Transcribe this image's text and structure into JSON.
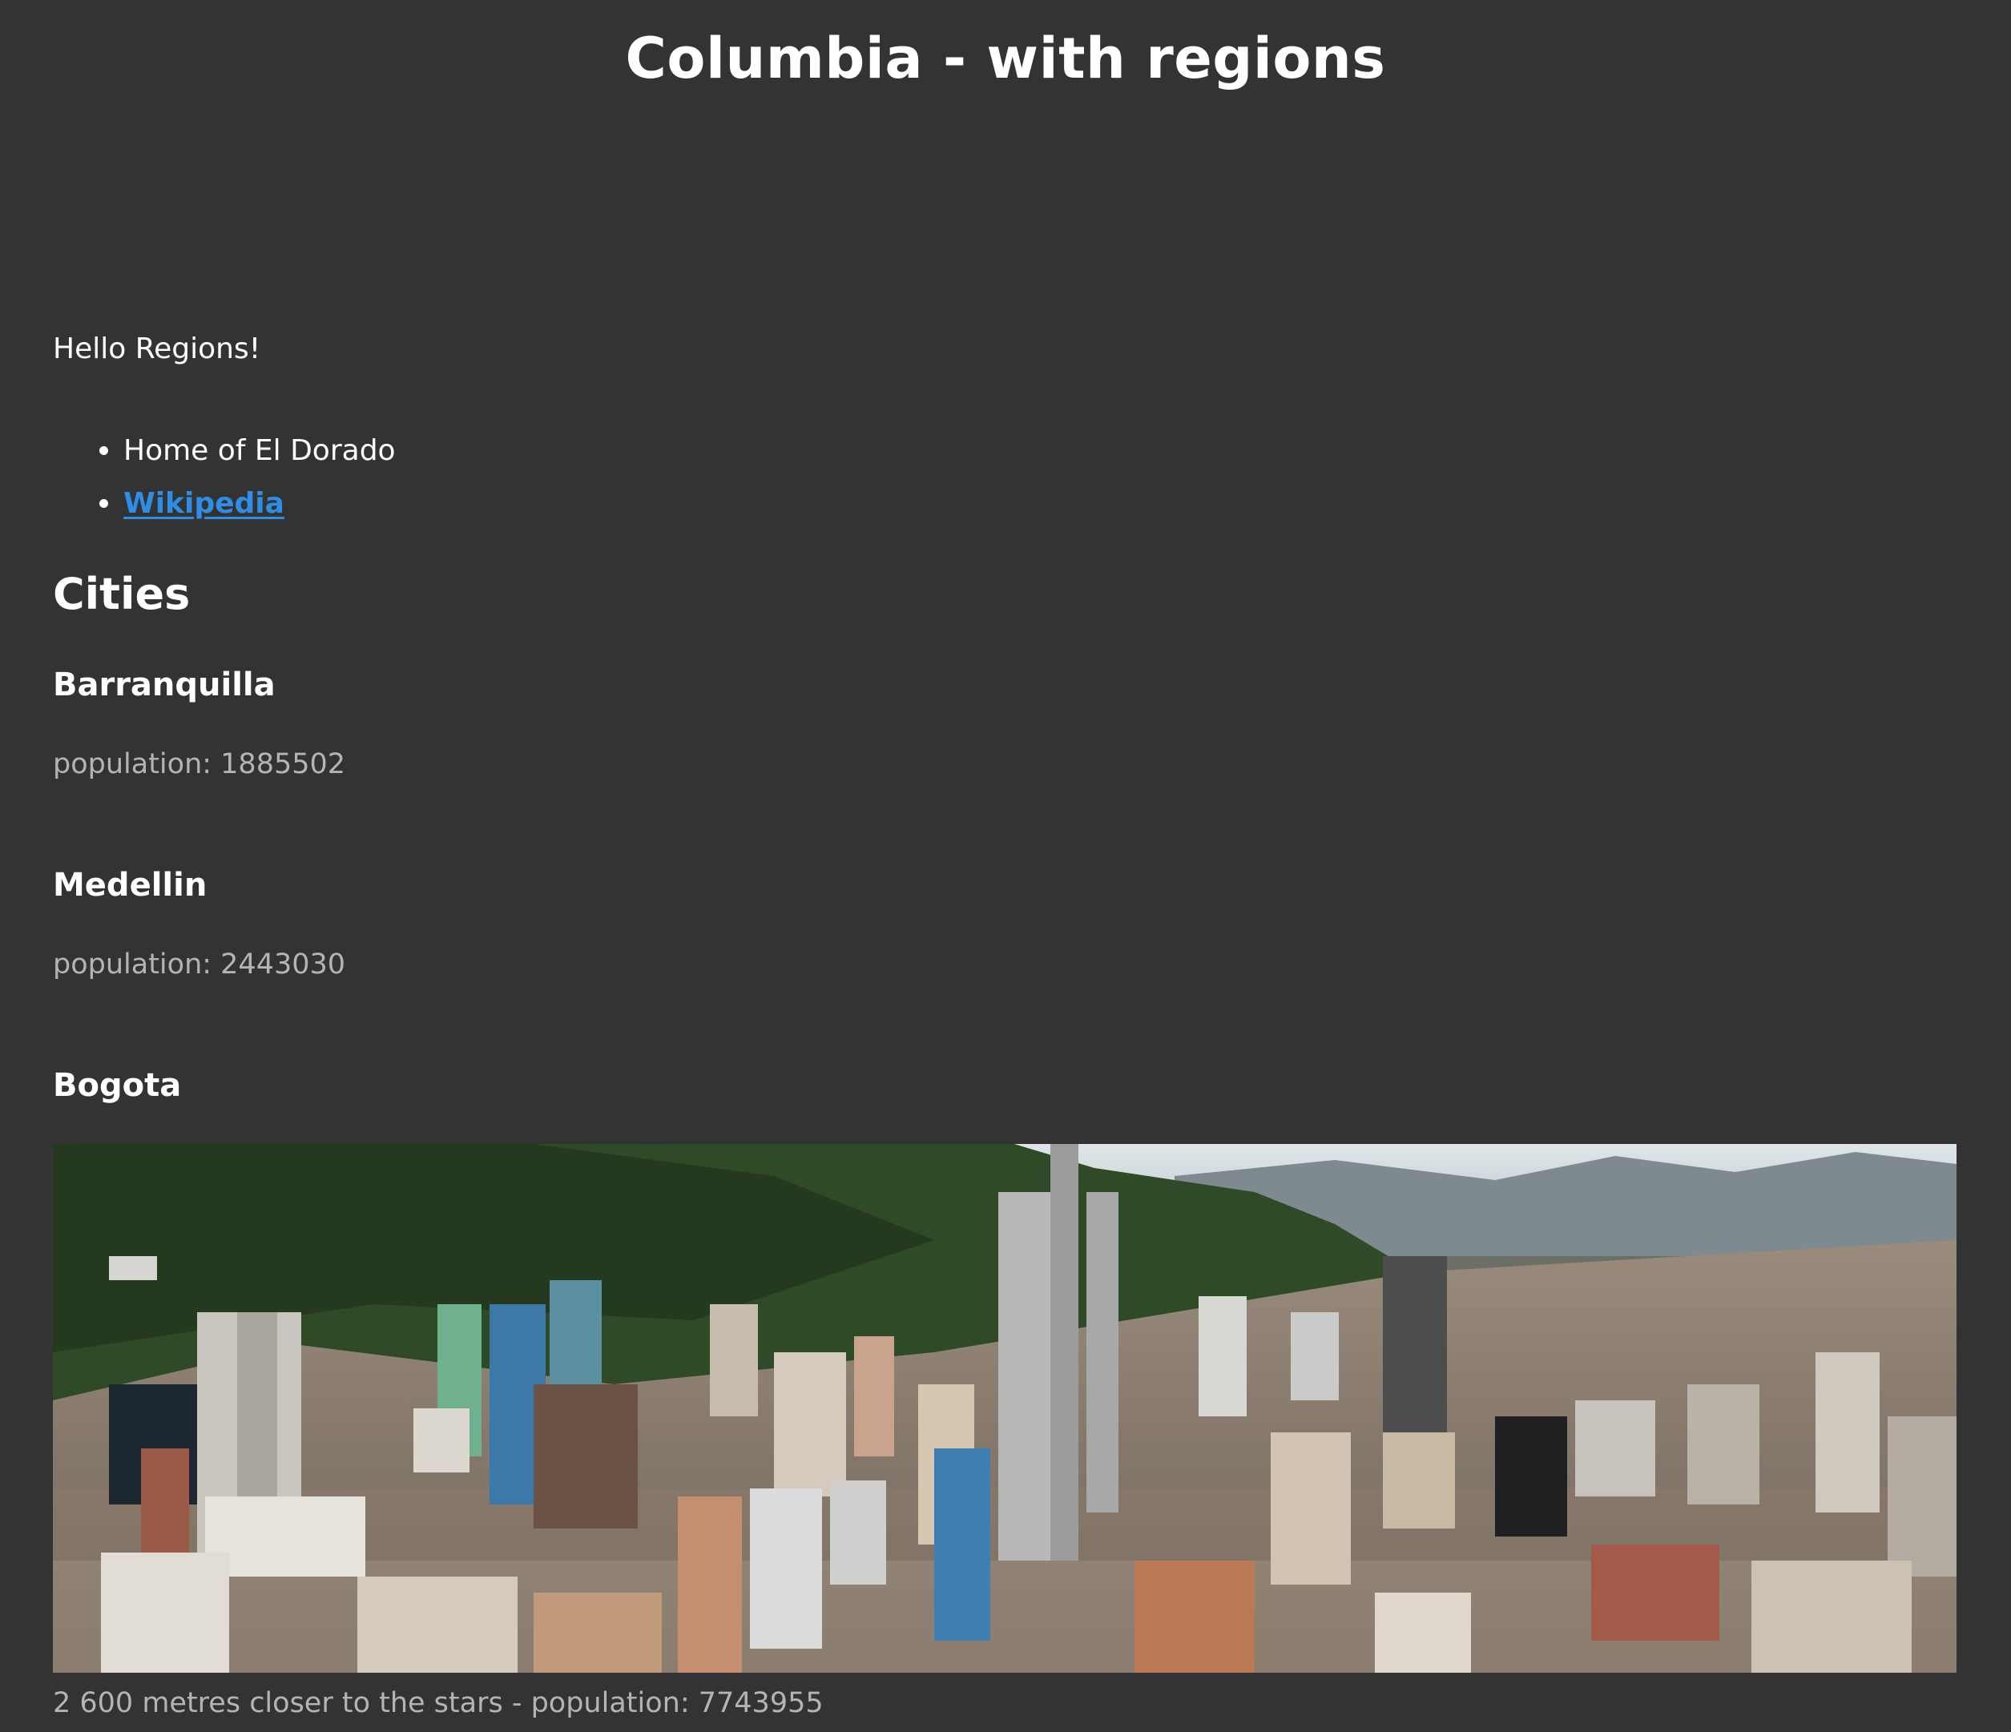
{
  "page": {
    "title": "Columbia - with regions",
    "intro": "Hello Regions!"
  },
  "facts": {
    "items": [
      {
        "label": "Home of El Dorado"
      },
      {
        "label": "Wikipedia",
        "is_link": true
      }
    ]
  },
  "cities": {
    "heading": "Cities",
    "list": [
      {
        "name": "Barranquilla",
        "population": "population: 1885502"
      },
      {
        "name": "Medellin",
        "population": "population: 2443030"
      },
      {
        "name": "Bogota",
        "caption": "2 600 metres closer to the stars - population: 7743955"
      }
    ]
  },
  "theme": {
    "background": "#333333",
    "text": "#ffffff",
    "muted": "#b4b4b4",
    "link": "#2e8de6"
  }
}
